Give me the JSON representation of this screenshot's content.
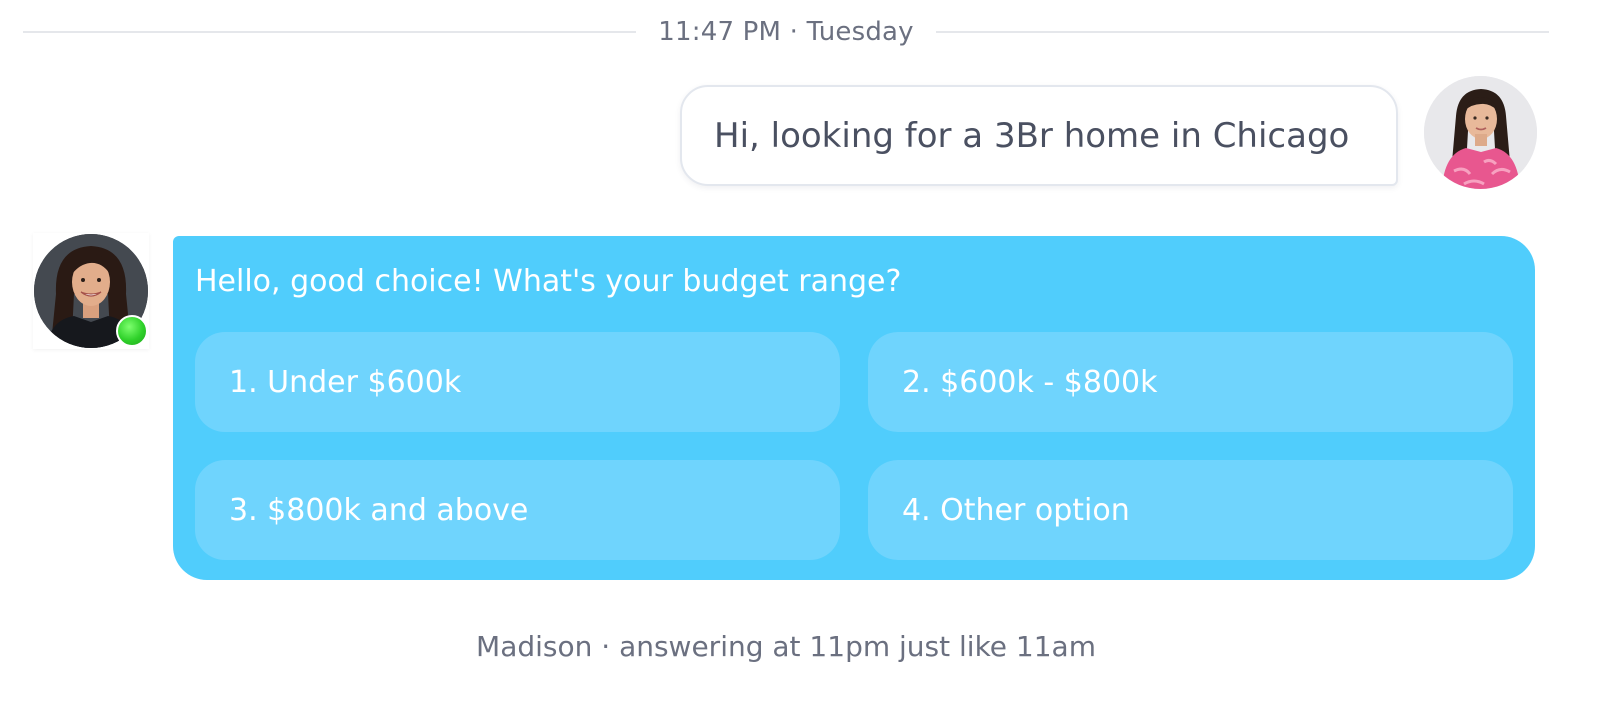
{
  "timestamp": "11:47 PM · Tuesday",
  "user_message": {
    "text": "Hi, looking for a 3Br home in Chicago",
    "avatar": "user-photo"
  },
  "agent_message": {
    "question": "Hello, good choice! What's your budget range?",
    "avatar": "agent-photo",
    "status": "online",
    "options": [
      {
        "label": "1. Under $600k"
      },
      {
        "label": "2. $600k - $800k"
      },
      {
        "label": "3. $800k and above"
      },
      {
        "label": "4. Other option"
      }
    ]
  },
  "footer": "Madison · answering at 11pm just like 11am",
  "colors": {
    "agent_bubble": "#50cdfc",
    "option_chip": "#6fd4fd",
    "online": "#2fd12a",
    "text": "#4a5061",
    "muted": "#6b7080"
  }
}
